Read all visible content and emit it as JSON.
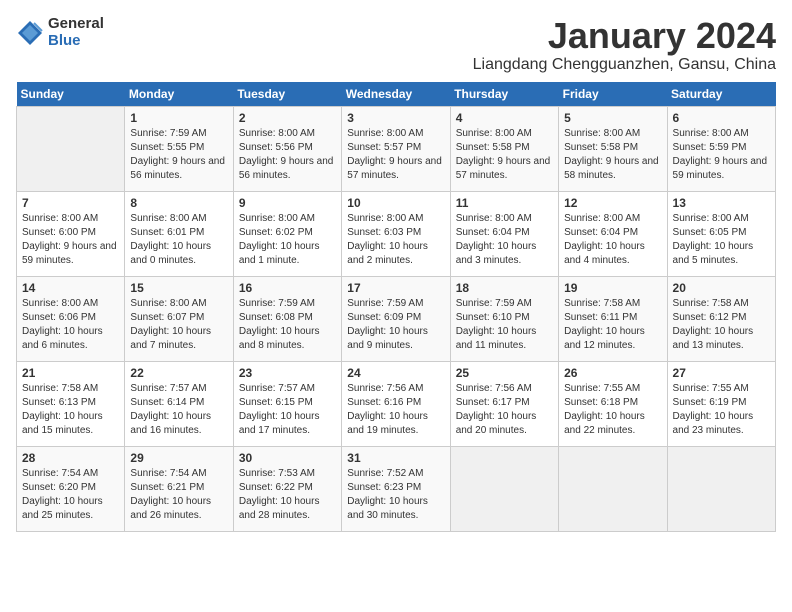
{
  "header": {
    "logo": {
      "general": "General",
      "blue": "Blue"
    },
    "title": "January 2024",
    "location": "Liangdang Chengguanzhen, Gansu, China"
  },
  "weekdays": [
    "Sunday",
    "Monday",
    "Tuesday",
    "Wednesday",
    "Thursday",
    "Friday",
    "Saturday"
  ],
  "weeks": [
    [
      {
        "day": null,
        "info": null
      },
      {
        "day": "1",
        "sunrise": "Sunrise: 7:59 AM",
        "sunset": "Sunset: 5:55 PM",
        "daylight": "Daylight: 9 hours and 56 minutes."
      },
      {
        "day": "2",
        "sunrise": "Sunrise: 8:00 AM",
        "sunset": "Sunset: 5:56 PM",
        "daylight": "Daylight: 9 hours and 56 minutes."
      },
      {
        "day": "3",
        "sunrise": "Sunrise: 8:00 AM",
        "sunset": "Sunset: 5:57 PM",
        "daylight": "Daylight: 9 hours and 57 minutes."
      },
      {
        "day": "4",
        "sunrise": "Sunrise: 8:00 AM",
        "sunset": "Sunset: 5:58 PM",
        "daylight": "Daylight: 9 hours and 57 minutes."
      },
      {
        "day": "5",
        "sunrise": "Sunrise: 8:00 AM",
        "sunset": "Sunset: 5:58 PM",
        "daylight": "Daylight: 9 hours and 58 minutes."
      },
      {
        "day": "6",
        "sunrise": "Sunrise: 8:00 AM",
        "sunset": "Sunset: 5:59 PM",
        "daylight": "Daylight: 9 hours and 59 minutes."
      }
    ],
    [
      {
        "day": "7",
        "sunrise": "Sunrise: 8:00 AM",
        "sunset": "Sunset: 6:00 PM",
        "daylight": "Daylight: 9 hours and 59 minutes."
      },
      {
        "day": "8",
        "sunrise": "Sunrise: 8:00 AM",
        "sunset": "Sunset: 6:01 PM",
        "daylight": "Daylight: 10 hours and 0 minutes."
      },
      {
        "day": "9",
        "sunrise": "Sunrise: 8:00 AM",
        "sunset": "Sunset: 6:02 PM",
        "daylight": "Daylight: 10 hours and 1 minute."
      },
      {
        "day": "10",
        "sunrise": "Sunrise: 8:00 AM",
        "sunset": "Sunset: 6:03 PM",
        "daylight": "Daylight: 10 hours and 2 minutes."
      },
      {
        "day": "11",
        "sunrise": "Sunrise: 8:00 AM",
        "sunset": "Sunset: 6:04 PM",
        "daylight": "Daylight: 10 hours and 3 minutes."
      },
      {
        "day": "12",
        "sunrise": "Sunrise: 8:00 AM",
        "sunset": "Sunset: 6:04 PM",
        "daylight": "Daylight: 10 hours and 4 minutes."
      },
      {
        "day": "13",
        "sunrise": "Sunrise: 8:00 AM",
        "sunset": "Sunset: 6:05 PM",
        "daylight": "Daylight: 10 hours and 5 minutes."
      }
    ],
    [
      {
        "day": "14",
        "sunrise": "Sunrise: 8:00 AM",
        "sunset": "Sunset: 6:06 PM",
        "daylight": "Daylight: 10 hours and 6 minutes."
      },
      {
        "day": "15",
        "sunrise": "Sunrise: 8:00 AM",
        "sunset": "Sunset: 6:07 PM",
        "daylight": "Daylight: 10 hours and 7 minutes."
      },
      {
        "day": "16",
        "sunrise": "Sunrise: 7:59 AM",
        "sunset": "Sunset: 6:08 PM",
        "daylight": "Daylight: 10 hours and 8 minutes."
      },
      {
        "day": "17",
        "sunrise": "Sunrise: 7:59 AM",
        "sunset": "Sunset: 6:09 PM",
        "daylight": "Daylight: 10 hours and 9 minutes."
      },
      {
        "day": "18",
        "sunrise": "Sunrise: 7:59 AM",
        "sunset": "Sunset: 6:10 PM",
        "daylight": "Daylight: 10 hours and 11 minutes."
      },
      {
        "day": "19",
        "sunrise": "Sunrise: 7:58 AM",
        "sunset": "Sunset: 6:11 PM",
        "daylight": "Daylight: 10 hours and 12 minutes."
      },
      {
        "day": "20",
        "sunrise": "Sunrise: 7:58 AM",
        "sunset": "Sunset: 6:12 PM",
        "daylight": "Daylight: 10 hours and 13 minutes."
      }
    ],
    [
      {
        "day": "21",
        "sunrise": "Sunrise: 7:58 AM",
        "sunset": "Sunset: 6:13 PM",
        "daylight": "Daylight: 10 hours and 15 minutes."
      },
      {
        "day": "22",
        "sunrise": "Sunrise: 7:57 AM",
        "sunset": "Sunset: 6:14 PM",
        "daylight": "Daylight: 10 hours and 16 minutes."
      },
      {
        "day": "23",
        "sunrise": "Sunrise: 7:57 AM",
        "sunset": "Sunset: 6:15 PM",
        "daylight": "Daylight: 10 hours and 17 minutes."
      },
      {
        "day": "24",
        "sunrise": "Sunrise: 7:56 AM",
        "sunset": "Sunset: 6:16 PM",
        "daylight": "Daylight: 10 hours and 19 minutes."
      },
      {
        "day": "25",
        "sunrise": "Sunrise: 7:56 AM",
        "sunset": "Sunset: 6:17 PM",
        "daylight": "Daylight: 10 hours and 20 minutes."
      },
      {
        "day": "26",
        "sunrise": "Sunrise: 7:55 AM",
        "sunset": "Sunset: 6:18 PM",
        "daylight": "Daylight: 10 hours and 22 minutes."
      },
      {
        "day": "27",
        "sunrise": "Sunrise: 7:55 AM",
        "sunset": "Sunset: 6:19 PM",
        "daylight": "Daylight: 10 hours and 23 minutes."
      }
    ],
    [
      {
        "day": "28",
        "sunrise": "Sunrise: 7:54 AM",
        "sunset": "Sunset: 6:20 PM",
        "daylight": "Daylight: 10 hours and 25 minutes."
      },
      {
        "day": "29",
        "sunrise": "Sunrise: 7:54 AM",
        "sunset": "Sunset: 6:21 PM",
        "daylight": "Daylight: 10 hours and 26 minutes."
      },
      {
        "day": "30",
        "sunrise": "Sunrise: 7:53 AM",
        "sunset": "Sunset: 6:22 PM",
        "daylight": "Daylight: 10 hours and 28 minutes."
      },
      {
        "day": "31",
        "sunrise": "Sunrise: 7:52 AM",
        "sunset": "Sunset: 6:23 PM",
        "daylight": "Daylight: 10 hours and 30 minutes."
      },
      {
        "day": null,
        "info": null
      },
      {
        "day": null,
        "info": null
      },
      {
        "day": null,
        "info": null
      }
    ]
  ]
}
